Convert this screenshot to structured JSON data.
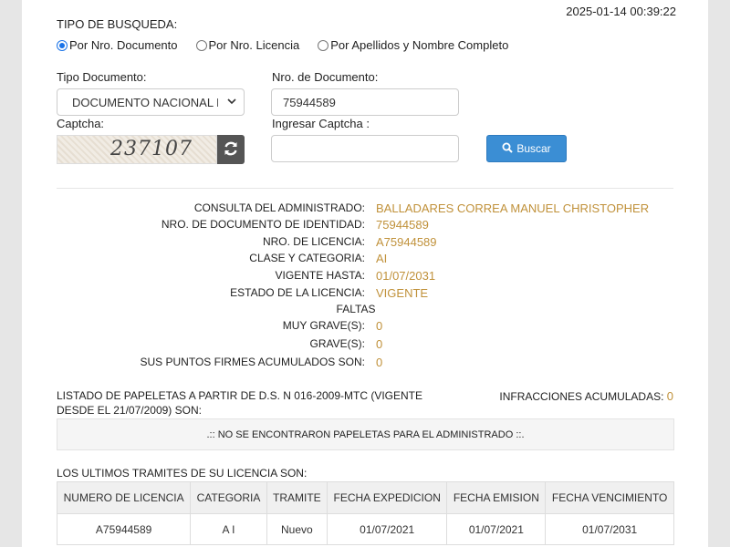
{
  "timestamp": "2025-01-14 00:39:22",
  "search": {
    "section_title": "TIPO DE BUSQUEDA:",
    "radio_options": [
      {
        "label": "Por Nro. Documento",
        "checked": true
      },
      {
        "label": "Por Nro. Licencia",
        "checked": false
      },
      {
        "label": "Por Apellidos y Nombre Completo",
        "checked": false
      }
    ],
    "tipo_documento_label": "Tipo Documento:",
    "tipo_documento_value": "DOCUMENTO NACIONAL DE",
    "nro_documento_label": "Nro. de Documento:",
    "nro_documento_value": "75944589",
    "captcha_label": "Captcha:",
    "captcha_text": "237107",
    "ingresar_captcha_label": "Ingresar Captcha :",
    "ingresar_captcha_value": "",
    "search_button_label": "Buscar"
  },
  "result": {
    "rows": [
      {
        "key": "CONSULTA DEL ADMINISTRADO:",
        "value": "BALLADARES CORREA MANUEL CHRISTOPHER"
      },
      {
        "key": "NRO. DE DOCUMENTO DE IDENTIDAD:",
        "value": "75944589"
      },
      {
        "key": "NRO. DE LICENCIA:",
        "value": "A75944589"
      },
      {
        "key": "CLASE Y CATEGORIA:",
        "value": "AI"
      },
      {
        "key": "VIGENTE HASTA:",
        "value": "01/07/2031"
      },
      {
        "key": "ESTADO DE LA LICENCIA:",
        "value": "VIGENTE"
      }
    ],
    "faltas_label": "FALTAS",
    "faltas_rows": [
      {
        "key": "MUY GRAVE(S):",
        "value": "0"
      },
      {
        "key": "GRAVE(S):",
        "value": "0"
      },
      {
        "key": "SUS PUNTOS FIRMES ACUMULADOS SON:",
        "value": "0"
      }
    ]
  },
  "papeletas": {
    "title": "LISTADO DE PAPELETAS A PARTIR DE D.S. N 016-2009-MTC (VIGENTE DESDE EL 21/07/2009) SON:",
    "infracciones_label": "INFRACCIONES ACUMULADAS:",
    "infracciones_value": "0",
    "empty_message": ".:: NO SE ENCONTRARON PAPELETAS PARA EL ADMINISTRADO ::."
  },
  "tramites": {
    "title": "LOS ULTIMOS TRAMITES DE SU LICENCIA SON:",
    "columns": [
      "NUMERO DE LICENCIA",
      "CATEGORIA",
      "TRAMITE",
      "FECHA EXPEDICION",
      "FECHA EMISION",
      "FECHA VENCIMIENTO"
    ],
    "rows": [
      [
        "A75944589",
        "A I",
        "Nuevo",
        "01/07/2021",
        "01/07/2021",
        "01/07/2031"
      ]
    ]
  },
  "colors": {
    "accent": "#3b8ed4",
    "value_gold": "#c0913a"
  }
}
